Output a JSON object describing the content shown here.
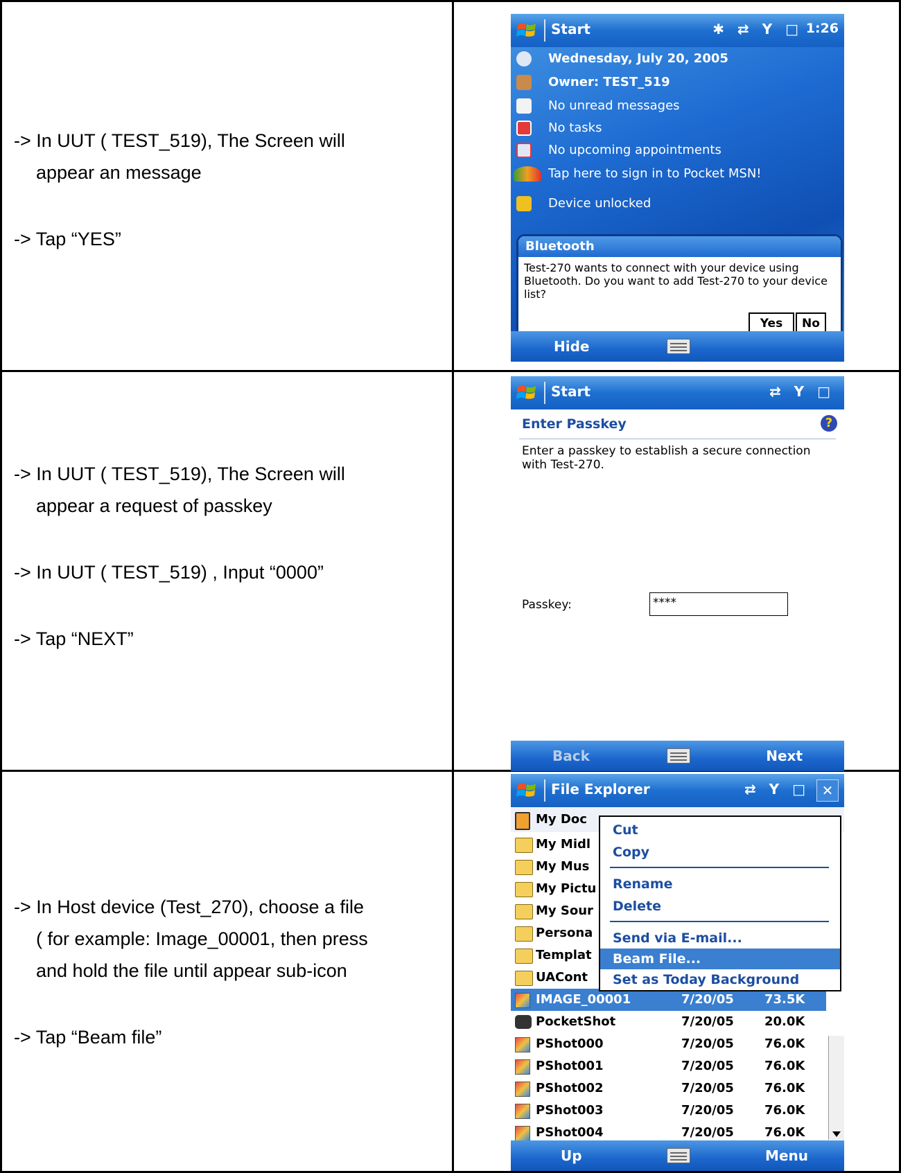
{
  "rows": [
    {
      "lines": [
        "-> In UUT ( TEST_519), The Screen will",
        "appear an message",
        "-> Tap “YES”"
      ]
    },
    {
      "lines": [
        "-> In UUT ( TEST_519), The Screen will",
        "appear a request of passkey",
        "-> In UUT ( TEST_519) , Input “0000”",
        "-> Tap “NEXT”"
      ]
    },
    {
      "lines": [
        "-> In Host device (Test_270), choose a file",
        "( for example: Image_00001, then press",
        "and hold the file until appear sub-icon",
        "-> Tap “Beam file”"
      ]
    }
  ],
  "screen1": {
    "title": "Start",
    "clock": "1:26",
    "status_icons": "✱ ⇄ Y □",
    "today_items": [
      {
        "label": "Wednesday, July 20, 2005",
        "icon": "clock-icon",
        "bold": true
      },
      {
        "label": "Owner: TEST_519",
        "icon": "owner-icon",
        "bold": true
      },
      {
        "label": "No unread messages",
        "icon": "mail-icon",
        "bold": false
      },
      {
        "label": "No tasks",
        "icon": "tasks-icon",
        "bold": false
      },
      {
        "label": "No upcoming appointments",
        "icon": "calendar-icon",
        "bold": false
      },
      {
        "label": "Tap here to sign in to Pocket MSN!",
        "icon": "msn-icon",
        "bold": false
      },
      {
        "label": "Device unlocked",
        "icon": "lock-icon",
        "bold": false
      }
    ],
    "dialog_title": "Bluetooth",
    "dialog_text": "Test-270 wants to connect with your device using Bluetooth. Do you want to add Test-270 to your device list?",
    "yes_label": "Yes",
    "no_label": "No",
    "left_soft": "Hide"
  },
  "screen2": {
    "title": "Start",
    "status_icons": "⇄ Y □",
    "heading": "Enter Passkey",
    "description": "Enter a passkey to establish a secure connection with Test-270.",
    "passkey_label": "Passkey:",
    "passkey_value": "****",
    "left_soft": "Back",
    "right_soft": "Next"
  },
  "screen3": {
    "title": "File Explorer",
    "status_icons": "⇄ Y □",
    "location": "My Doc",
    "folders": [
      "My Midl",
      "My Mus",
      "My Pictu",
      "My Sour",
      "Persona",
      "Templat",
      "UACont"
    ],
    "files": [
      {
        "name": "IMAGE_00001",
        "date": "7/20/05",
        "size": "73.5K",
        "icon": "image-file-icon"
      },
      {
        "name": "PocketShot",
        "date": "7/20/05",
        "size": "20.0K",
        "icon": "camera-icon"
      },
      {
        "name": "PShot000",
        "date": "7/20/05",
        "size": "76.0K",
        "icon": "image-file-icon"
      },
      {
        "name": "PShot001",
        "date": "7/20/05",
        "size": "76.0K",
        "icon": "image-file-icon"
      },
      {
        "name": "PShot002",
        "date": "7/20/05",
        "size": "76.0K",
        "icon": "image-file-icon"
      },
      {
        "name": "PShot003",
        "date": "7/20/05",
        "size": "76.0K",
        "icon": "image-file-icon"
      },
      {
        "name": "PShot004",
        "date": "7/20/05",
        "size": "76.0K",
        "icon": "image-file-icon"
      }
    ],
    "menu": [
      "Cut",
      "Copy",
      "Rename",
      "Delete",
      "Send via E-mail...",
      "Beam File...",
      "Set as Today Background"
    ],
    "left_soft": "Up",
    "right_soft": "Menu"
  },
  "colors": {
    "accent": "#1e6fd0",
    "selection": "#3a7fd0",
    "menu_text": "#1c4ea0"
  }
}
